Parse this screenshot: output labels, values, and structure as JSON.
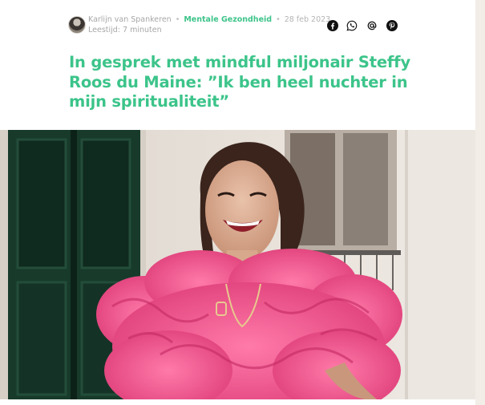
{
  "meta": {
    "author": "Karlijn van Spankeren",
    "category": "Mentale Gezondheid",
    "date": "28 feb 2023",
    "reading_time": "Leestijd: 7 minuten"
  },
  "share": {
    "icons": [
      "facebook-icon",
      "whatsapp-icon",
      "email-at-icon",
      "pinterest-icon"
    ]
  },
  "article": {
    "title": "In gesprek met mindful miljonair Steffy Roos du Maine: ”Ik ben heel nuchter in mijn spiritualiteit”"
  },
  "colors": {
    "accent": "#3cc48a",
    "muted_text": "#a7a7a7",
    "dress": "#f2508f"
  }
}
